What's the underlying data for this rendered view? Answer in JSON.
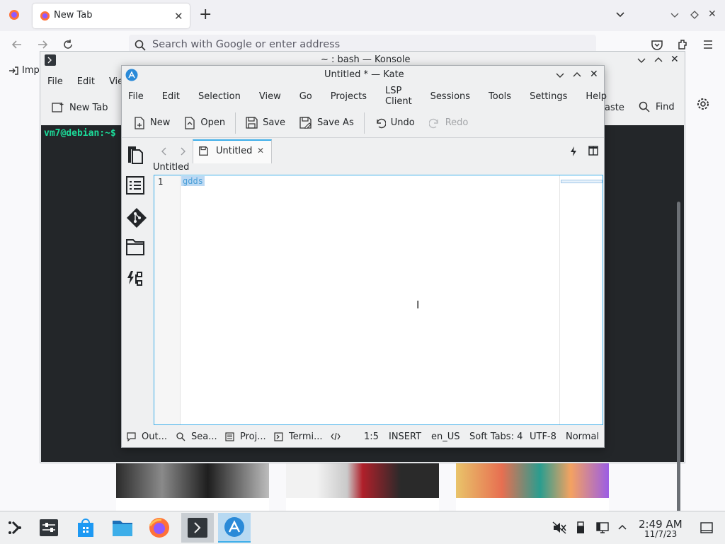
{
  "firefox": {
    "tab_title": "New Tab",
    "url_placeholder": "Search with Google or enter address",
    "bookmark_import": "Imp"
  },
  "konsole": {
    "title": "~ : bash — Konsole",
    "menu": [
      "File",
      "Edit",
      "Vie"
    ],
    "new_tab": "New Tab",
    "paste": "aste",
    "find": "Find",
    "prompt": "vm7@debian:~$"
  },
  "kate": {
    "title": "Untitled * — Kate",
    "menu": [
      "File",
      "Edit",
      "Selection",
      "View",
      "Go",
      "Projects",
      "LSP Client",
      "Sessions",
      "Tools",
      "Settings",
      "Help"
    ],
    "toolbar": {
      "new": "New",
      "open": "Open",
      "save": "Save",
      "save_as": "Save As",
      "undo": "Undo",
      "redo": "Redo"
    },
    "doc_tab": "Untitled",
    "breadcrumb": "Untitled",
    "line_number": "1",
    "content": "gdds",
    "status": {
      "output": "Out...",
      "search": "Sea...",
      "projects": "Proj...",
      "terminal": "Termi...",
      "cursor": "1:5",
      "mode": "INSERT",
      "lang": "en_US",
      "tabs": "Soft Tabs: 4",
      "encoding": "UTF-8",
      "input": "Normal"
    }
  },
  "taskbar": {
    "time": "2:49 AM",
    "date": "11/7/23"
  },
  "colors": {
    "accent": "#3daee9",
    "terminal_bg": "#232629",
    "prompt": "#1cdc9a"
  }
}
